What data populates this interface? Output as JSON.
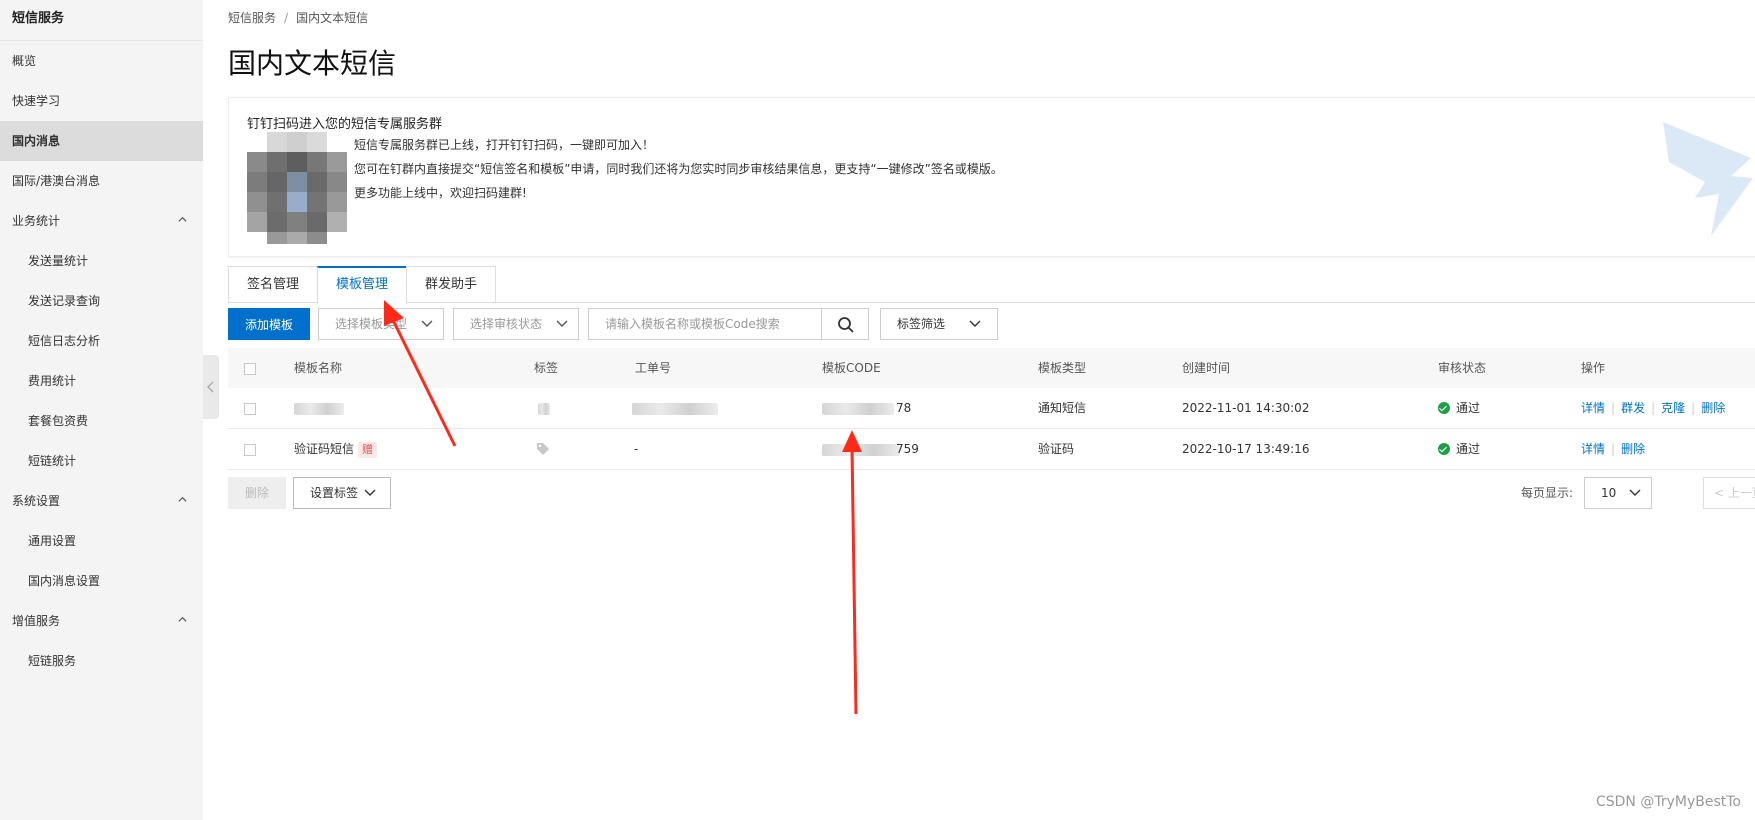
{
  "sidebar": {
    "title": "短信服务",
    "items": [
      {
        "label": "概览"
      },
      {
        "label": "快速学习"
      },
      {
        "label": "国内消息"
      },
      {
        "label": "国际/港澳台消息"
      },
      {
        "label": "业务统计"
      },
      {
        "label": "发送量统计"
      },
      {
        "label": "发送记录查询"
      },
      {
        "label": "短信日志分析"
      },
      {
        "label": "费用统计"
      },
      {
        "label": "套餐包资费"
      },
      {
        "label": "短链统计"
      },
      {
        "label": "系统设置"
      },
      {
        "label": "通用设置"
      },
      {
        "label": "国内消息设置"
      },
      {
        "label": "增值服务"
      },
      {
        "label": "短链服务"
      }
    ]
  },
  "breadcrumb": {
    "root": "短信服务",
    "separator": "/",
    "current": "国内文本短信"
  },
  "page": {
    "title": "国内文本短信"
  },
  "banner": {
    "title": "钉钉扫码进入您的短信专属服务群",
    "lines": [
      "短信专属服务群已上线，打开钉钉扫码，一键即可加入！",
      "您可在钉群内直接提交“短信签名和模板”申请，同时我们还将为您实时同步审核结果信息，更支持“一键修改”签名或模版。",
      "更多功能上线中，欢迎扫码建群!"
    ]
  },
  "tabs": [
    {
      "label": "签名管理",
      "active": false
    },
    {
      "label": "模板管理",
      "active": true
    },
    {
      "label": "群发助手",
      "active": false
    }
  ],
  "toolbar": {
    "add_label": "添加模板",
    "type_select_placeholder": "选择模板类型",
    "status_select_placeholder": "选择审核状态",
    "search_placeholder": "请输入模板名称或模板Code搜索",
    "tag_filter_label": "标签筛选"
  },
  "table": {
    "columns": [
      "模板名称",
      "标签",
      "工单号",
      "模板CODE",
      "模板类型",
      "创建时间",
      "审核状态",
      "操作"
    ],
    "rows": [
      {
        "name": "",
        "badge": "",
        "order": "",
        "code_suffix": "78",
        "type": "通知短信",
        "created": "2022-11-01 14:30:02",
        "status": "通过",
        "actions": [
          "详情",
          "群发",
          "克隆",
          "删除"
        ]
      },
      {
        "name": "验证码短信",
        "badge": "赠",
        "order": "-",
        "code_suffix": "759",
        "type": "验证码",
        "created": "2022-10-17 13:49:16",
        "status": "通过",
        "actions": [
          "详情",
          "删除"
        ]
      }
    ]
  },
  "footer": {
    "delete_label": "删除",
    "set_tag_label": "设置标签",
    "page_size_label": "每页显示:",
    "page_size_value": "10",
    "prev_label": "上一页"
  },
  "watermark": "CSDN @TryMyBestTo",
  "colors": {
    "primary": "#0070cc",
    "annotation": "#ff2a1a",
    "success": "#1e9e4a"
  }
}
